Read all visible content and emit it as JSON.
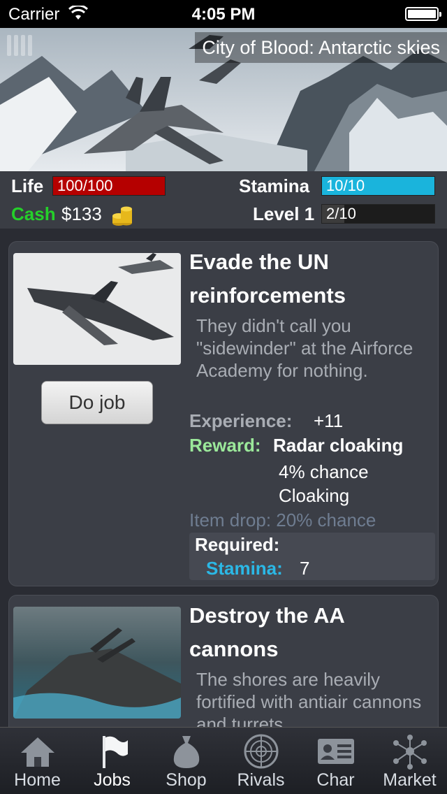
{
  "status_bar": {
    "carrier": "Carrier",
    "time": "4:05 PM"
  },
  "banner": {
    "title": "City of Blood: Antarctic skies"
  },
  "stats": {
    "life_label": "Life",
    "life_value": "100/100",
    "life_fraction": 1.0,
    "stamina_label": "Stamina",
    "stamina_value": "10/10",
    "stamina_fraction": 1.0,
    "cash_label": "Cash",
    "cash_value": "$133",
    "level_label": "Level 1",
    "level_value": "2/10",
    "level_fraction": 0.2
  },
  "jobs": [
    {
      "title": "Evade the UN reinforcements",
      "description": "They didn't call you \"sidewinder\" at the Airforce Academy for nothing.",
      "button": "Do job",
      "experience_label": "Experience:",
      "experience_value": "+11",
      "reward_label": "Reward:",
      "reward_value": "Radar cloaking",
      "reward_chance": "4% chance",
      "reward_type": "Cloaking",
      "item_drop": "Item drop: 20% chance",
      "required_label": "Required:",
      "required_stat_label": "Stamina:",
      "required_stat_value": "7"
    },
    {
      "title": "Destroy the AA cannons",
      "description": "The shores are heavily fortified with antiair cannons and turrets."
    }
  ],
  "tabs": [
    {
      "label": "Home",
      "icon": "home-icon"
    },
    {
      "label": "Jobs",
      "icon": "flag-icon"
    },
    {
      "label": "Shop",
      "icon": "money-bag-icon"
    },
    {
      "label": "Rivals",
      "icon": "radar-icon"
    },
    {
      "label": "Char",
      "icon": "id-card-icon"
    },
    {
      "label": "Market",
      "icon": "network-icon"
    }
  ],
  "colors": {
    "life_bar": "#b50000",
    "stamina_bar": "#1ab4dc",
    "level_bar": "#3c3c3c",
    "cash_label": "#25d02a",
    "reward_label": "#9be89a",
    "stamina_label": "#2bb8e6",
    "item_drop": "#6f7d91"
  }
}
